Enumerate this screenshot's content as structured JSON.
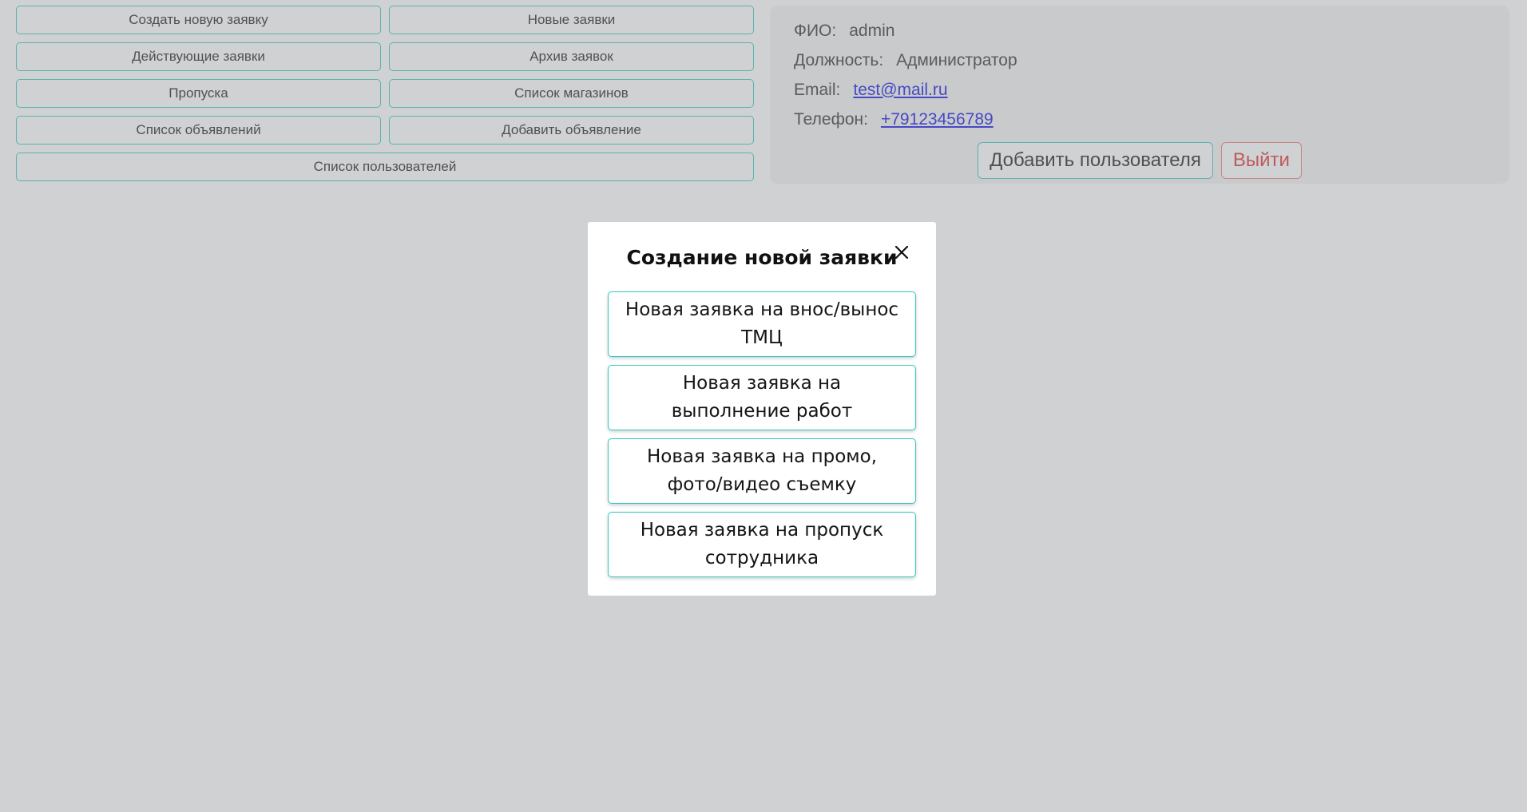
{
  "nav": {
    "buttons": [
      "Создать новую заявку",
      "Новые заявки",
      "Действующие заявки",
      "Архив заявок",
      "Пропуска",
      "Список магазинов",
      "Список объявлений",
      "Добавить объявление",
      "Список пользователей"
    ]
  },
  "profile": {
    "fio_label": "ФИО:",
    "fio_value": "admin",
    "position_label": "Должность:",
    "position_value": "Администратор",
    "email_label": "Email:",
    "email_value": "test@mail.ru",
    "phone_label": "Телефон:",
    "phone_value": "+79123456789",
    "add_user_label": "Добавить пользователя",
    "logout_label": "Выйти"
  },
  "modal": {
    "title": "Создание новой заявки",
    "close_icon": "close-icon",
    "options": [
      "Новая заявка на внос/вынос ТМЦ",
      "Новая заявка на выполнение работ",
      "Новая заявка на промо, фото/видео съемку",
      "Новая заявка на пропуск сотрудника"
    ]
  },
  "colors": {
    "accent": "#33c9c2",
    "danger": "#e04a4a",
    "link": "#2b2ee8",
    "overlay": "#787c82"
  }
}
